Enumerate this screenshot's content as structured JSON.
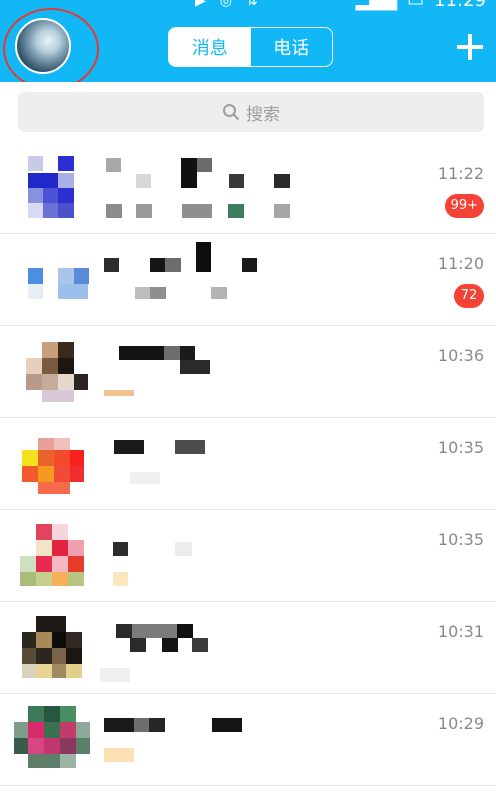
{
  "status_bar": {
    "time": "11:29"
  },
  "header": {
    "tabs": [
      {
        "label": "消息",
        "active": true
      },
      {
        "label": "电话",
        "active": false
      }
    ],
    "add_icon": "plus-icon",
    "accent_color": "#12b7f5"
  },
  "search": {
    "placeholder": "搜索"
  },
  "conversations": [
    {
      "time": "11:22",
      "badge": "99+"
    },
    {
      "time": "11:20",
      "badge": "72"
    },
    {
      "time": "10:36",
      "badge": ""
    },
    {
      "time": "10:35",
      "badge": ""
    },
    {
      "time": "10:35",
      "badge": ""
    },
    {
      "time": "10:31",
      "badge": ""
    },
    {
      "time": "10:29",
      "badge": ""
    }
  ]
}
